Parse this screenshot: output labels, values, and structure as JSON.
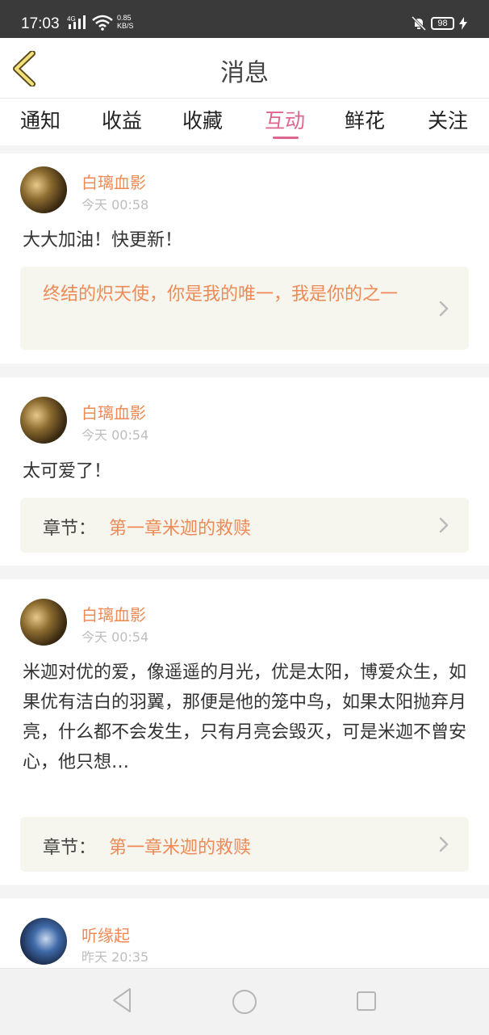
{
  "status_bar": {
    "time": "17:03",
    "network": "4G",
    "speed_value": "0.85",
    "speed_unit": "KB/S",
    "battery": "98"
  },
  "header": {
    "title": "消息",
    "back_icon": "chevron-left-icon",
    "accent_color": "#e0648f",
    "name_color": "#ee8a55"
  },
  "tabs": [
    {
      "label": "通知"
    },
    {
      "label": "收益"
    },
    {
      "label": "收藏"
    },
    {
      "label": "互动",
      "active": true
    },
    {
      "label": "鲜花"
    },
    {
      "label": "关注"
    }
  ],
  "messages": [
    {
      "username": "白璃血影",
      "time": "今天 00:58",
      "text": "大大加油！快更新！",
      "ref_quote": "终结的炽天使，你是我的唯一，我是你的之一"
    },
    {
      "username": "白璃血影",
      "time": "今天 00:54",
      "text": "太可爱了！",
      "ref_label": "章节：",
      "ref_chapter": "第一章米迦的救赎"
    },
    {
      "username": "白璃血影",
      "time": "今天 00:54",
      "text": "米迦对优的爱，像遥遥的月光，优是太阳，博爱众生，如果优有洁白的羽翼，那便是他的笼中鸟，如果太阳抛弃月亮，什么都不会发生，只有月亮会毁灭，可是米迦不曾安心，他只想…",
      "ref_label": "章节：",
      "ref_chapter": "第一章米迦的救赎"
    },
    {
      "username": "听缘起",
      "time": "昨天 20:35"
    }
  ],
  "nav": {
    "back": "triangle-back-icon",
    "home": "circle-home-icon",
    "recent": "square-recent-icon"
  }
}
